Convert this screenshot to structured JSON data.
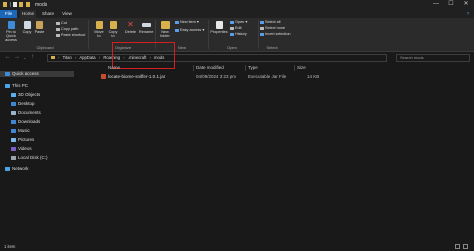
{
  "window": {
    "title": "mods",
    "controls": {
      "minimize": "—",
      "maximize": "☐",
      "close": "✕",
      "help": "?"
    }
  },
  "ribbon_tabs": [
    "File",
    "Home",
    "Share",
    "View"
  ],
  "ribbon": {
    "clipboard": {
      "pin": "Pin to Quick access",
      "copy": "Copy",
      "paste": "Paste",
      "cut": "Cut",
      "copy_path": "Copy path",
      "paste_shortcut": "Paste shortcut",
      "group": "Clipboard"
    },
    "organize": {
      "move_to": "Move to",
      "copy_to": "Copy to",
      "delete": "Delete",
      "rename": "Rename",
      "group": "Organize"
    },
    "new": {
      "new_folder": "New folder",
      "new_item": "New item ▾",
      "easy_access": "Easy access ▾",
      "group": "New"
    },
    "open": {
      "properties": "Properties",
      "open": "Open ▾",
      "edit": "Edit",
      "history": "History",
      "group": "Open"
    },
    "select": {
      "select_all": "Select all",
      "select_none": "Select none",
      "invert": "Invert selection",
      "group": "Select"
    }
  },
  "address": {
    "crumbs": [
      "Titan",
      "AppData",
      "Roaming",
      ".minecraft",
      "mods"
    ],
    "separator": "›",
    "search_placeholder": "Search mods"
  },
  "nav_pane": {
    "items": [
      {
        "label": "Quick access",
        "icon": "star-icon",
        "color": "#3d8bd9"
      },
      {
        "label": "This PC",
        "icon": "computer-icon",
        "color": "#4aa3e6"
      },
      {
        "label": "3D Objects",
        "icon": "cube-icon",
        "color": "#5ab0e8"
      },
      {
        "label": "Desktop",
        "icon": "desktop-icon",
        "color": "#3f86d6"
      },
      {
        "label": "Documents",
        "icon": "documents-icon",
        "color": "#9bb4c9"
      },
      {
        "label": "Downloads",
        "icon": "downloads-icon",
        "color": "#3f86d6"
      },
      {
        "label": "Music",
        "icon": "music-icon",
        "color": "#3f86d6"
      },
      {
        "label": "Pictures",
        "icon": "pictures-icon",
        "color": "#7fb7e6"
      },
      {
        "label": "Videos",
        "icon": "videos-icon",
        "color": "#7b5ec6"
      },
      {
        "label": "Local Disk (C:)",
        "icon": "drive-icon",
        "color": "#9aa4ad"
      },
      {
        "label": "Network",
        "icon": "network-icon",
        "color": "#4aa3e6"
      }
    ]
  },
  "columns": [
    "Name",
    "Date modified",
    "Type",
    "Size"
  ],
  "files": [
    {
      "name": "locate-biome-sniffer-1.0.1.jar",
      "modified": "04/09/2024 3:23 pm",
      "type": "Executable Jar File",
      "size": "14 KB"
    }
  ],
  "status": {
    "items": "1 item"
  },
  "colors": {
    "accent": "#1a67b8",
    "highlight": "#d21f1f",
    "background": "#191919"
  }
}
